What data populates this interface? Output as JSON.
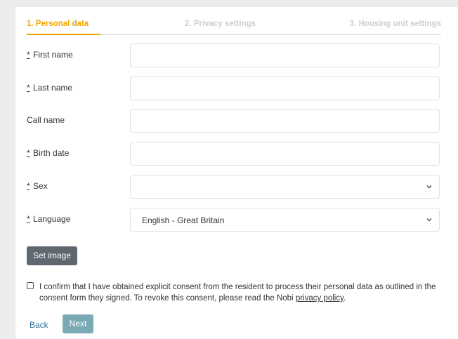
{
  "steps": {
    "step1": "1. Personal data",
    "step2": "2. Privacy settings",
    "step3": "3. Housing unit settings"
  },
  "form": {
    "required_marker": "*",
    "first_name": {
      "label": "First name",
      "value": ""
    },
    "last_name": {
      "label": "Last name",
      "value": ""
    },
    "call_name": {
      "label": "Call name",
      "value": ""
    },
    "birth_date": {
      "label": "Birth date",
      "value": ""
    },
    "sex": {
      "label": "Sex",
      "value": ""
    },
    "language": {
      "label": "Language",
      "value": "English - Great Britain"
    }
  },
  "set_image_label": "Set image",
  "consent": {
    "text": "I confirm that I have obtained explicit consent from the resident to process their personal data as outlined in the consent form they signed. To revoke this consent, please read the Nobi ",
    "link_text": "privacy policy",
    "suffix": ".",
    "checked": false
  },
  "buttons": {
    "back": "Back",
    "next": "Next"
  },
  "colors": {
    "active_step": "#f2a700",
    "inactive_step": "#cfcfcf",
    "set_image_bg": "#5f6870",
    "next_bg": "#7aaab3",
    "back_text": "#2e6f94"
  },
  "icons": {
    "select_chevron": "chevron-down-icon",
    "checkbox": "checkbox-unchecked"
  }
}
